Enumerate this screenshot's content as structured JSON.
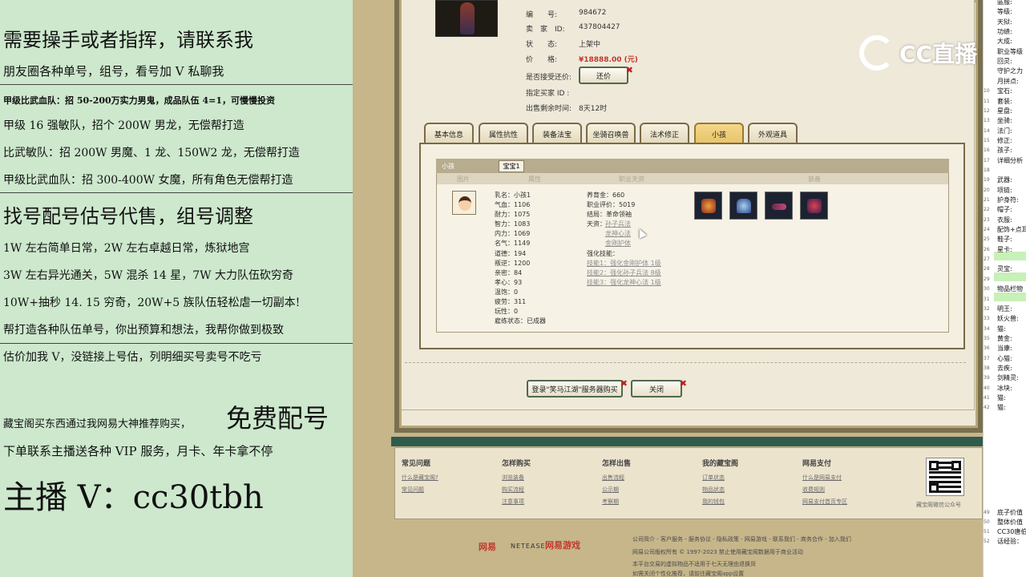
{
  "stream_overlay": {
    "lines": [
      "需要操手或者指挥，请联系我",
      "朋友圈各种单号，组号，看号加 V 私聊我",
      "甲级比武血队：招 50-200万实力男鬼，成品队伍 4=1，可慢慢投资",
      "甲级 16 强敏队，招个 200W 男龙，无偿帮打造",
      "比武敏队：招 200W 男魔、1 龙、150W2 龙，无偿帮打造",
      "甲级比武血队：招 300-400W 女魔，所有角色无偿帮打造",
      "找号配号估号代售，组号调整",
      "1W 左右简单日常，2W 左右卓越日常，炼狱地宫",
      "3W 左右异光通关，5W 混杀 14 星，7W 大力队伍砍穷奇",
      "10W+抽秒 14. 15 穷奇，20W+5 族队伍轻松虐一切副本!",
      "帮打造各种队伍单号，你出预算和想法，我帮你做到极致",
      "估价加我 V，没链接上号估，列明细买号卖号不吃亏",
      "藏宝阁买东西通过我网易大神推荐购买，",
      "免费配号",
      "下单联系主播送各种 VIP 服务，月卡、年卡拿不停",
      "主播 V：cc30tbh"
    ]
  },
  "listing": {
    "labels": {
      "id": "编　　号:",
      "seller": "卖　家　ID:",
      "status": "状　　态:",
      "price": "价　　格:",
      "accept_counter": "是否接受还价:",
      "buyer_id": "指定买家 ID :",
      "time_left": "出售剩余时间:"
    },
    "values": {
      "id": "984672",
      "seller": "437804427",
      "status": "上架中",
      "price": "¥18888.00 (元)",
      "time_left": "8天12时"
    },
    "counter_button": "还价"
  },
  "tabs": [
    "基本信息",
    "属性抗性",
    "装备法宝",
    "坐骑召唤兽",
    "法术修正",
    "小孩",
    "外观道具"
  ],
  "active_tab": "小孩",
  "child": {
    "panel_title": "小孩",
    "sub_tab": "宝宝1",
    "columns": [
      "图片",
      "属性",
      "职业天资",
      "装备"
    ],
    "stats": [
      "乳名：小孩1",
      "气血：1106",
      "耐力：1075",
      "智力：1083",
      "内力：1069",
      "名气：1149",
      "道德：194",
      "叛逆：1200",
      "亲密：84",
      "孝心：93",
      "温饱：0",
      "疲劳：311",
      "玩性：0",
      "雇练状态：已成器"
    ],
    "career": [
      "养育金：660",
      "职业评价：5019",
      "结局：革命领袖",
      "天资："
    ],
    "talents": [
      "孙子兵法",
      "龙神心法",
      "金刚护体"
    ],
    "enhance_title": "强化技能：",
    "enhance": [
      "技能1：强化金刚护体 1级",
      "技能2：强化孙子兵法 8级",
      "技能3：强化龙神心法 1级"
    ]
  },
  "bottom_buttons": {
    "login": "登录\"笑马江湖\"服务器购买",
    "close": "关闭"
  },
  "footer": {
    "columns": [
      {
        "title": "常见问题",
        "links": [
          "什么是藏宝阁?",
          "常见问题"
        ]
      },
      {
        "title": "怎样购买",
        "links": [
          "浏览装备",
          "购买流程",
          "注意事项"
        ]
      },
      {
        "title": "怎样出售",
        "links": [
          "出售流程",
          "公示期",
          "考察期"
        ]
      },
      {
        "title": "我的藏宝阁",
        "links": [
          "订单状态",
          "物品状态",
          "我的钱包"
        ]
      },
      {
        "title": "网易支付",
        "links": [
          "什么是网易支付",
          "收费规则",
          "网易支付首页专区"
        ]
      }
    ],
    "qr_caption": "藏宝阁微信公众号",
    "links_line": "公司简介 - 客户服务 - 服务协议 - 隐私政策 - 网易游戏 - 联系我们 - 商务合作 - 加入我们",
    "copyright": "网易公司版权所有 © 1997-2023 禁止使用藏宝阁数据用于商业活动",
    "notice1": "本平台交易的虚拟物品不适用于七天无理由退换货",
    "notice2": "如需关闭个性化推荐，请前往藏宝阁app设置",
    "logo_netease_cn": "网易",
    "logo_netease_en": "NETEASE",
    "logo_games": "网易游戏"
  },
  "cc_logo_text": "CC直播",
  "sidebar": {
    "rows": [
      {
        "n": "",
        "label": "區服:"
      },
      {
        "n": "",
        "label": "等级:"
      },
      {
        "n": "",
        "label": "天狱:"
      },
      {
        "n": "",
        "label": "功绩:"
      },
      {
        "n": "",
        "label": "大成:"
      },
      {
        "n": "",
        "label": "职业等级"
      },
      {
        "n": "",
        "label": "回灵:"
      },
      {
        "n": "",
        "label": "守护之力"
      },
      {
        "n": "",
        "label": "月拼点:"
      },
      {
        "n": "10",
        "label": "宝石:"
      },
      {
        "n": "11",
        "label": "套装:"
      },
      {
        "n": "12",
        "label": "星盘:"
      },
      {
        "n": "13",
        "label": "坐骑:"
      },
      {
        "n": "14",
        "label": "法门:"
      },
      {
        "n": "15",
        "label": "修正:"
      },
      {
        "n": "16",
        "label": "孩子:"
      },
      {
        "n": "17",
        "label": "详细分析"
      },
      {
        "n": "18",
        "label": ""
      },
      {
        "n": "19",
        "label": "武器:"
      },
      {
        "n": "20",
        "label": "项链:"
      },
      {
        "n": "21",
        "label": "护身符:"
      },
      {
        "n": "22",
        "label": "帽子:"
      },
      {
        "n": "23",
        "label": "衣服:"
      },
      {
        "n": "24",
        "label": "配饰+点耳"
      },
      {
        "n": "25",
        "label": "鞋子:"
      },
      {
        "n": "26",
        "label": "星卡:"
      },
      {
        "n": "27",
        "label": ""
      },
      {
        "n": "28",
        "label": "灵宝:"
      },
      {
        "n": "29",
        "label": ""
      },
      {
        "n": "30",
        "label": "物品栏物"
      },
      {
        "n": "31",
        "label": ""
      },
      {
        "n": "32",
        "label": "明王:"
      },
      {
        "n": "33",
        "label": "妖火兽:"
      },
      {
        "n": "34",
        "label": "猫:"
      },
      {
        "n": "35",
        "label": "黄金:"
      },
      {
        "n": "36",
        "label": "当康:"
      },
      {
        "n": "37",
        "label": "心猫:"
      },
      {
        "n": "38",
        "label": "去疾:"
      },
      {
        "n": "39",
        "label": "剑精灵:"
      },
      {
        "n": "40",
        "label": "冰块:"
      },
      {
        "n": "41",
        "label": "猫:"
      },
      {
        "n": "42",
        "label": "猫:"
      }
    ],
    "bottom": [
      {
        "n": "49",
        "label": "底子价值"
      },
      {
        "n": "50",
        "label": "整体价值"
      },
      {
        "n": "51",
        "label": "CC30唐伯"
      },
      {
        "n": "52",
        "label": "话经验："
      }
    ]
  }
}
